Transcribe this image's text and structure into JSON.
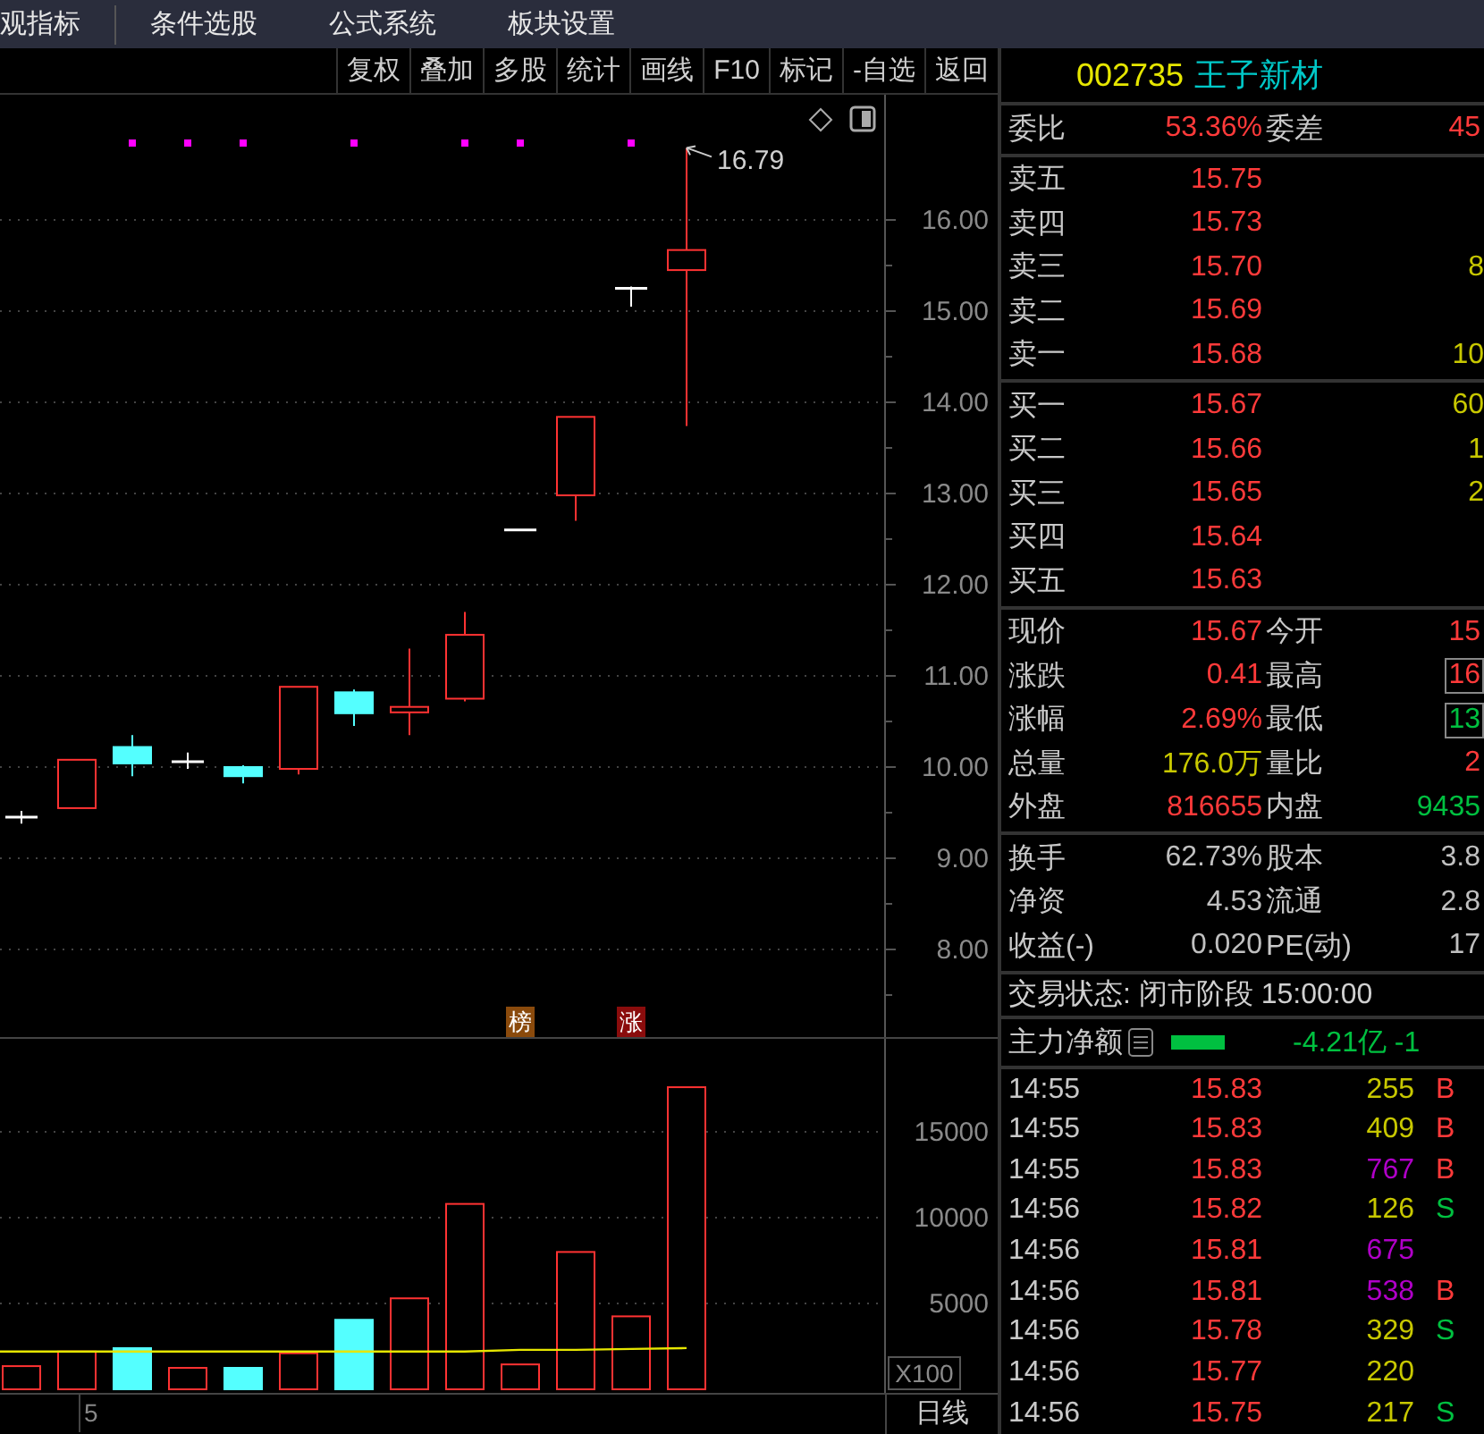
{
  "menu": [
    "观指标",
    "条件选股",
    "公式系统",
    "板块设置"
  ],
  "toolbar": [
    "复权",
    "叠加",
    "多股",
    "统计",
    "画线",
    "F10",
    "标记",
    "-自选",
    "返回"
  ],
  "price_chart": {
    "axis_labels": [
      "16.00",
      "15.00",
      "14.00",
      "13.00",
      "12.00",
      "11.00",
      "10.00",
      "9.00",
      "8.00"
    ],
    "high_label": "16.79",
    "signal_tags": [
      {
        "label": "榜",
        "color": "#8a4a0c"
      },
      {
        "label": "涨",
        "color": "#8a0c0c"
      }
    ]
  },
  "volume_chart": {
    "axis_labels": [
      "15000",
      "10000",
      "5000"
    ],
    "unit": "X100",
    "date_label": "5",
    "period": "日线"
  },
  "quote_header": {
    "code": "002735",
    "name": "王子新材"
  },
  "order_ratio": [
    {
      "label": "委比",
      "value": "53.36%",
      "color": "#ff3a3a"
    },
    {
      "label": "委差",
      "value": "45",
      "color": "#ff3a3a"
    }
  ],
  "asks": [
    {
      "label": "卖五",
      "price": "15.75"
    },
    {
      "label": "卖四",
      "price": "15.73"
    },
    {
      "label": "卖三",
      "price": "15.70",
      "volume": "8"
    },
    {
      "label": "卖二",
      "price": "15.69"
    },
    {
      "label": "卖一",
      "price": "15.68",
      "volume": "10"
    }
  ],
  "bids": [
    {
      "label": "买一",
      "price": "15.67",
      "volume": "60"
    },
    {
      "label": "买二",
      "price": "15.66",
      "volume": "1"
    },
    {
      "label": "买三",
      "price": "15.65",
      "volume": "2"
    },
    {
      "label": "买四",
      "price": "15.64"
    },
    {
      "label": "买五",
      "price": "15.63"
    }
  ],
  "stats": [
    [
      [
        {
          "label": "现价",
          "value": "15.67",
          "color": "#ff3a3a",
          "boxed": false
        },
        {
          "label": "今开",
          "value": "15",
          "color": "#ff3a3a",
          "boxed": false
        }
      ],
      [
        {
          "label": "涨跌",
          "value": "0.41",
          "color": "#ff3a3a",
          "boxed": false
        },
        {
          "label": "最高",
          "value": "16",
          "color": "#ff3a3a",
          "boxed": true
        }
      ],
      [
        {
          "label": "涨幅",
          "value": "2.69%",
          "color": "#ff3a3a",
          "boxed": false
        },
        {
          "label": "最低",
          "value": "13",
          "color": "#00c040",
          "boxed": true
        }
      ],
      [
        {
          "label": "总量",
          "value": "176.0万",
          "color": "#c8c800",
          "boxed": false
        },
        {
          "label": "量比",
          "value": "2",
          "color": "#ff3a3a",
          "boxed": false
        }
      ],
      [
        {
          "label": "外盘",
          "value": "816655",
          "color": "#ff3a3a",
          "boxed": false
        },
        {
          "label": "内盘",
          "value": "9435",
          "color": "#00c040",
          "boxed": false
        }
      ]
    ],
    [
      [
        {
          "label": "换手",
          "value": "62.73%",
          "color": "#c0c0c0",
          "boxed": false
        },
        {
          "label": "股本",
          "value": "3.8",
          "color": "#c0c0c0",
          "boxed": false
        }
      ],
      [
        {
          "label": "净资",
          "value": "4.53",
          "color": "#c0c0c0",
          "boxed": false
        },
        {
          "label": "流通",
          "value": "2.8",
          "color": "#c0c0c0",
          "boxed": false
        }
      ],
      [
        {
          "label": "收益(-)",
          "value": "0.020",
          "color": "#c0c0c0",
          "boxed": false
        },
        {
          "label": "PE(动)",
          "value": "17",
          "color": "#c0c0c0",
          "boxed": false
        }
      ]
    ]
  ],
  "status": "交易状态: 闭市阶段 15:00:00",
  "main_flow": {
    "label": "主力净额",
    "value": "-4.21亿 -1"
  },
  "ticks": [
    {
      "time": "14:55",
      "price": "15.83",
      "volume": "255",
      "color": "#c8c800",
      "kind": "buy",
      "side": "B"
    },
    {
      "time": "14:55",
      "price": "15.83",
      "volume": "409",
      "color": "#c8c800",
      "kind": "buy",
      "side": "B"
    },
    {
      "time": "14:55",
      "price": "15.83",
      "volume": "767",
      "color": "#b000c8",
      "kind": "buy",
      "side": "B"
    },
    {
      "time": "14:56",
      "price": "15.82",
      "volume": "126",
      "color": "#c8c800",
      "kind": "sell",
      "side": "S"
    },
    {
      "time": "14:56",
      "price": "15.81",
      "volume": "675",
      "color": "#b000c8",
      "kind": "none"
    },
    {
      "time": "14:56",
      "price": "15.81",
      "volume": "538",
      "color": "#b000c8",
      "kind": "buy",
      "side": "B"
    },
    {
      "time": "14:56",
      "price": "15.78",
      "volume": "329",
      "color": "#c8c800",
      "kind": "sell",
      "side": "S"
    },
    {
      "time": "14:56",
      "price": "15.77",
      "volume": "220",
      "color": "#c8c800",
      "kind": "none"
    },
    {
      "time": "14:56",
      "price": "15.75",
      "volume": "217",
      "color": "#c8c800",
      "kind": "sell",
      "side": "S"
    }
  ]
}
